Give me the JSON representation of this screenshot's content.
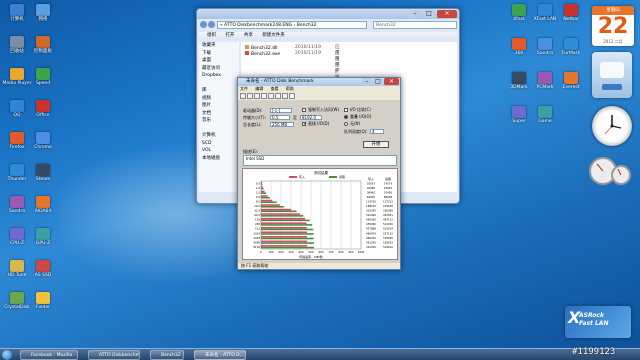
{
  "colors": {
    "desktop": "#1a73c5",
    "taskbar": "#25456d",
    "write_bar": "#d44a6e",
    "read_bar": "#4f8a3a"
  },
  "explorer": {
    "address": "« ATTO Diskbenchmark248.ENG › Bench32",
    "search": "Bench32",
    "menu": [
      "组织",
      "打开",
      "共享",
      "新建文件夹"
    ],
    "nav": [
      "收藏夹",
      "下载",
      "桌面",
      "最近访问",
      "Dropbox",
      "",
      "库",
      "视频",
      "图片",
      "文档",
      "音乐",
      "",
      "计算机",
      "SCD",
      "VOL",
      "本地磁盘"
    ],
    "files": [
      {
        "name": "Bench32.dll",
        "date": "2010/11/19",
        "type": "应用程序扩展"
      },
      {
        "name": "Bench32.exe",
        "date": "2010/11/19",
        "type": "应用程序"
      }
    ]
  },
  "bench": {
    "title": "未命名 - ATTO Disk Benchmark",
    "menu": [
      "文件",
      "编辑",
      "查看",
      "帮助"
    ],
    "labels": {
      "drive": "驱动器(D):",
      "transfer": "传输大小(T):",
      "to": "至",
      "total": "总长度(L):",
      "force_write": "强制写入访问(W)",
      "direct_io": "直接 I/O(D)",
      "io_compare": "I/O 比较(C)",
      "overlapped": "重叠 I/O(O)",
      "neither": "无(N)",
      "queue": "队列深度(Q):",
      "start": "开始",
      "desc_label": "描述(E):",
      "chart_title": "测试结果",
      "write_legend": "写入",
      "read_legend": "读取",
      "write_col": "写入",
      "read_col": "读取",
      "xaxis": "传输速率 - MB/秒",
      "status": "按 F1 获取帮助"
    },
    "values": {
      "drive": "[-c-]",
      "transfer_from": "0.5",
      "transfer_to": "8192.0",
      "total": "256 MB",
      "queue": "4",
      "desc": "Intel SSD"
    }
  },
  "chart_data": {
    "type": "bar",
    "title": "测试结果",
    "xlabel": "传输速率 - MB/秒",
    "categories": [
      "0.5",
      "1.0",
      "2.0",
      "4.0",
      "8.0",
      "16.0",
      "32.0",
      "64.0",
      "128",
      "256",
      "512",
      "1024",
      "2048",
      "4096",
      "8192"
    ],
    "series": [
      {
        "name": "写入",
        "values": [
          10,
          19,
          36,
          65,
          114,
          188,
          302,
          391,
          440,
          455,
          458,
          460,
          461,
          461,
          462
        ]
      },
      {
        "name": "读取",
        "values": [
          14,
          26,
          51,
          89,
          157,
          229,
          356,
          423,
          487,
          512,
          523,
          527,
          528,
          529,
          530
        ]
      }
    ],
    "table_write": [
      "10657",
      "20980",
      "36462",
      "64930",
      "114720",
      "188150",
      "302345",
      "391096",
      "440260",
      "455090",
      "457888",
      "460074",
      "460910",
      "461240",
      "461520"
    ],
    "table_read": [
      "14579",
      "25852",
      "51450",
      "89058",
      "157212",
      "229180",
      "356060",
      "423051",
      "487112",
      "512240",
      "523014",
      "527132",
      "528095",
      "528922",
      "529610"
    ],
    "xlim": [
      0,
      1000
    ],
    "xticks": [
      "0",
      "100",
      "200",
      "300",
      "400",
      "500",
      "600",
      "700",
      "800",
      "900",
      "1000"
    ]
  },
  "desktop_icons": [
    {
      "label": "计算机"
    },
    {
      "label": "网络"
    },
    {
      "label": "回收站"
    },
    {
      "label": "控制面板"
    },
    {
      "label": "Media Player"
    },
    {
      "label": "Speed"
    },
    {
      "label": "QQ"
    },
    {
      "label": "Office"
    },
    {
      "label": "Firefox"
    },
    {
      "label": "Chrome"
    },
    {
      "label": "Thunder"
    },
    {
      "label": "Steam"
    },
    {
      "label": "Sandra"
    },
    {
      "label": "AIDA64"
    },
    {
      "label": "CPU-Z"
    },
    {
      "label": "GPU-Z"
    },
    {
      "label": "HD Tune"
    },
    {
      "label": "AS SSD"
    },
    {
      "label": "CrystalDisk"
    },
    {
      "label": "Folder"
    }
  ],
  "right_icons": [
    {
      "label": "Xfast"
    },
    {
      "label": "XFast LAN"
    },
    {
      "label": "Netbar"
    },
    {
      "label": "360"
    },
    {
      "label": "Sandra"
    },
    {
      "label": "FurMark"
    },
    {
      "label": "3DMark"
    },
    {
      "label": "PCMark"
    },
    {
      "label": "Everest"
    },
    {
      "label": "Super"
    },
    {
      "label": "Game"
    }
  ],
  "gadgets": {
    "calendar_head": "星期四",
    "calendar_day": "22",
    "calendar_sub": "2012 二月",
    "asrock_line1": "ASRock",
    "asrock_line2": "Fast LAN"
  },
  "taskbar": {
    "items": [
      "Facebook - Mozilla",
      "ATTO Diskbenchmar...",
      "Bench32",
      "未命名 - ATTO D..."
    ]
  },
  "watermark": "#1199123"
}
